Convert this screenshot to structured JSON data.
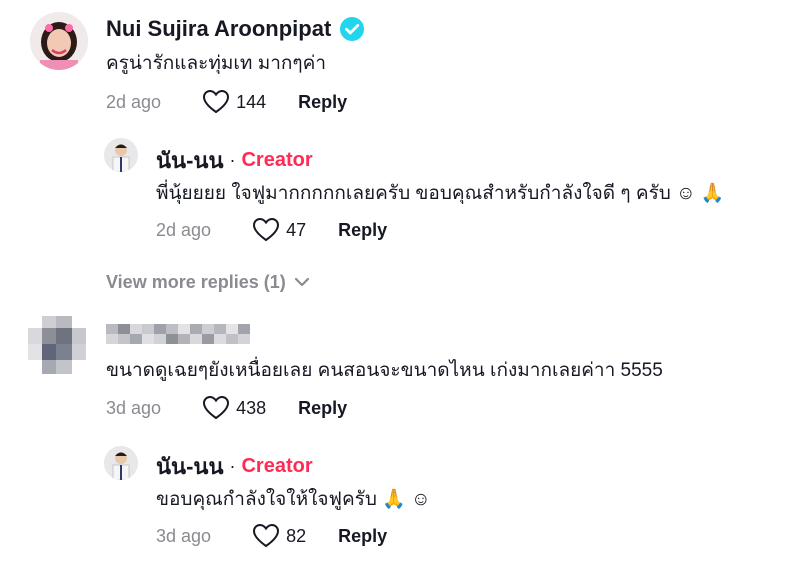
{
  "comments": [
    {
      "author": "Nui Sujira Aroonpipat",
      "verified": true,
      "text": "ครูน่ารักและทุ่มเท มากๆค่า",
      "time": "2d ago",
      "likes": "144",
      "reply_label": "Reply",
      "reply": {
        "author": "นัน-นน",
        "separator": "·",
        "badge": "Creator",
        "text": "พี่นุ้ยยยย ใจฟูมากกกกกเลยครับ ขอบคุณสำหรับกำลังใจดี ๆ ครับ ☺ 🙏",
        "time": "2d ago",
        "likes": "47",
        "reply_label": "Reply"
      },
      "view_more": "View more replies (1)"
    },
    {
      "author": "",
      "author_blurred": true,
      "text": "ขนาดดูเฉยๆยังเหนื่อยเลย คนสอนจะขนาดไหน เก่งมากเลยค่าา 5555",
      "time": "3d ago",
      "likes": "438",
      "reply_label": "Reply",
      "reply": {
        "author": "นัน-นน",
        "separator": "·",
        "badge": "Creator",
        "text": "ขอบคุณกำลังใจให้ใจฟูครับ 🙏 ☺",
        "time": "3d ago",
        "likes": "82",
        "reply_label": "Reply"
      }
    }
  ],
  "colors": {
    "creator": "#fe2c55",
    "verified": "#20d5ec",
    "muted": "#8a8b91",
    "text": "#161823"
  },
  "icons": [
    "heart-outline-icon",
    "verified-badge-icon",
    "chevron-down-icon",
    "avatar"
  ]
}
